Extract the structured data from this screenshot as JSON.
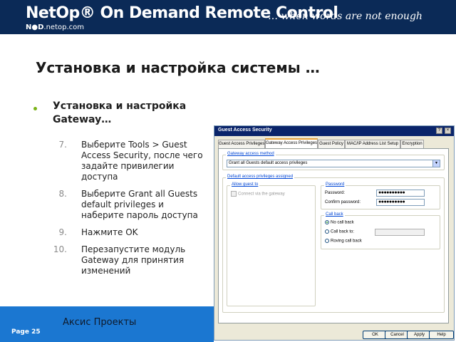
{
  "header": {
    "brand": "NetOp® On Demand Remote Control",
    "tagline": "… when words are not enough",
    "sublogo_mark": "N●D",
    "sublogo_domain": ".netop.com"
  },
  "slide": {
    "title": "Установка и настройка системы …",
    "bullet": "Установка и настройка Gateway…",
    "steps": [
      {
        "num": "7.",
        "text": "Выберите Tools > Guest Access Security, после чего задайте привилегии доступа"
      },
      {
        "num": "8.",
        "text": "Выберите Grant all Guests default privileges и наберите пароль доступа"
      },
      {
        "num": "9.",
        "text": "Нажмите OK"
      },
      {
        "num": "10.",
        "text": "Перезапустите модуль Gateway для принятия изменений"
      }
    ],
    "footer_center": "Аксис Проекты",
    "page_label": "Page 25"
  },
  "dialog": {
    "title": "Guest Access Security",
    "controls": {
      "help": "?",
      "close": "×"
    },
    "tabs": [
      "Guest Access Privileges",
      "Gateway Access Privileges",
      "Guest Policy",
      "MAC/IP Address List Setup",
      "Encryption"
    ],
    "active_tab": "Gateway Access Privileges",
    "access_method": {
      "label": "Gateway access method",
      "value": "Grant all Guests default access privileges"
    },
    "default_privileges": {
      "label": "Default access privileges assigned",
      "allow_label": "Allow guest to",
      "allow_option": "Connect via the gateway"
    },
    "password": {
      "label": "Password",
      "password_label": "Password:",
      "password_value": "●●●●●●●●●●",
      "confirm_label": "Confirm password:",
      "confirm_value": "●●●●●●●●●●"
    },
    "callback": {
      "label": "Call back",
      "options": [
        "No call back",
        "Call back to:",
        "Roving call back"
      ]
    },
    "buttons": [
      "OK",
      "Cancel",
      "Apply",
      "Help"
    ]
  },
  "colors": {
    "banner": "#0b2a57",
    "bullet": "#7ab317",
    "footer_band": "#1b77d1",
    "dialog_titlebar": "#0a246a"
  }
}
